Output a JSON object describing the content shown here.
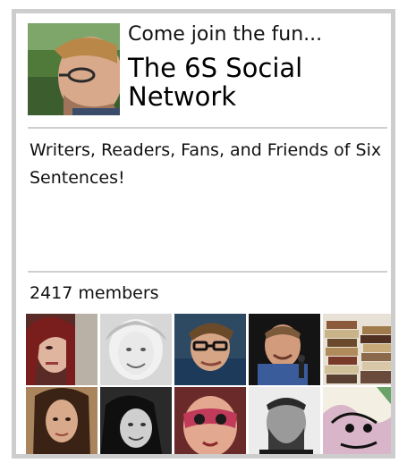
{
  "badge": {
    "tagline": "Come join the fun...",
    "title": "The 6S Social Network",
    "description": "Writers, Readers, Fans, and Friends of Six Sentences!",
    "member_count": "2417 members"
  },
  "member_photos": [
    {
      "icon": "member-photo-woman-red-hair"
    },
    {
      "icon": "member-photo-blonde-woman-bw"
    },
    {
      "icon": "member-photo-man-glasses"
    },
    {
      "icon": "member-photo-man-speaking"
    },
    {
      "icon": "member-photo-stacked-books"
    },
    {
      "icon": "member-photo-woman-long-hair"
    },
    {
      "icon": "member-photo-woman-bw-smiling"
    },
    {
      "icon": "member-photo-mask-red"
    },
    {
      "icon": "member-photo-man-bw-beard"
    },
    {
      "icon": "member-photo-comic-art"
    }
  ],
  "colors": {
    "border": "#cdcdcd",
    "divider": "#cfcfcf",
    "text": "#111111"
  }
}
